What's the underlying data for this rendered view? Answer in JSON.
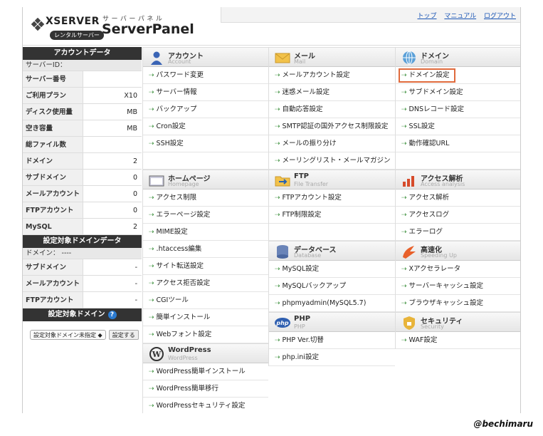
{
  "header": {
    "logo_word": "XSERVER",
    "logo_badge": "レンタルサーバー",
    "panel_sub": "サーバーパネル",
    "panel_title": "ServerPanel",
    "links": [
      "トップ",
      "マニュアル",
      "ログアウト"
    ]
  },
  "account_data": {
    "heading": "アカウントデータ",
    "server_id_label": "サーバーID：",
    "rows": [
      {
        "k": "サーバー番号",
        "v": ""
      },
      {
        "k": "ご利用プラン",
        "v": "X10"
      },
      {
        "k": "ディスク使用量",
        "v": "MB"
      },
      {
        "k": "空き容量",
        "v": "MB"
      },
      {
        "k": "総ファイル数",
        "v": ""
      },
      {
        "k": "ドメイン",
        "v": "2"
      },
      {
        "k": "サブドメイン",
        "v": "0"
      },
      {
        "k": "メールアカウント",
        "v": "0"
      },
      {
        "k": "FTPアカウント",
        "v": "0"
      },
      {
        "k": "MySQL",
        "v": "2"
      }
    ]
  },
  "target_domain_data": {
    "heading": "設定対象ドメインデータ",
    "domain_label": "ドメイン： ----",
    "rows": [
      {
        "k": "サブドメイン",
        "v": "-"
      },
      {
        "k": "メールアカウント",
        "v": "-"
      },
      {
        "k": "FTPアカウント",
        "v": "-"
      }
    ]
  },
  "target_domain": {
    "heading": "設定対象ドメイン",
    "help": "?",
    "select_value": "設定対象ドメイン未指定 ◆",
    "set_button": "設定する"
  },
  "columns": [
    [
      {
        "title": "アカウント",
        "en": "Account",
        "icon": "person-icon",
        "items": [
          "パスワード変更",
          "サーバー情報",
          "バックアップ",
          "Cron設定",
          "SSH設定",
          ""
        ]
      },
      {
        "title": "ホームページ",
        "en": "Homepage",
        "icon": "homepage-icon",
        "items": [
          "アクセス制限",
          "エラーページ設定",
          "MIME設定",
          ".htaccess編集",
          "サイト転送設定",
          "アクセス拒否設定",
          "CGIツール",
          "簡単インストール",
          "Webフォント設定"
        ]
      },
      {
        "title": "WordPress",
        "en": "WordPress",
        "icon": "wordpress-icon",
        "items": [
          "WordPress簡単インストール",
          "WordPress簡単移行",
          "WordPressセキュリティ設定"
        ]
      }
    ],
    [
      {
        "title": "メール",
        "en": "Mail",
        "icon": "mail-icon",
        "items": [
          "メールアカウント設定",
          "迷惑メール設定",
          "自動応答設定",
          "SMTP認証の国外アクセス制限設定",
          "メールの振り分け",
          "メーリングリスト・メールマガジン"
        ]
      },
      {
        "title": "FTP",
        "en": "File Transfer",
        "icon": "ftp-folder-icon",
        "items": [
          "FTPアカウント設定",
          "FTP制限設定",
          ""
        ]
      },
      {
        "title": "データベース",
        "en": "Database",
        "icon": "database-icon",
        "items": [
          "MySQL設定",
          "MySQLバックアップ",
          "phpmyadmin(MySQL5.7)"
        ]
      },
      {
        "title": "PHP",
        "en": "PHP",
        "icon": "php-icon",
        "items": [
          "PHP Ver.切替",
          "php.ini設定"
        ]
      }
    ],
    [
      {
        "title": "ドメイン",
        "en": "Domain",
        "icon": "globe-icon",
        "items": [
          "ドメイン設定",
          "サブドメイン設定",
          "DNSレコード設定",
          "SSL設定",
          "動作確認URL",
          ""
        ]
      },
      {
        "title": "アクセス解析",
        "en": "Access analysis",
        "icon": "chart-icon",
        "items": [
          "アクセス解析",
          "アクセスログ",
          "エラーログ"
        ]
      },
      {
        "title": "高速化",
        "en": "Speeding Up",
        "icon": "speed-icon",
        "items": [
          "Xアクセラレータ",
          "サーバーキャッシュ設定",
          "ブラウザキャッシュ設定"
        ]
      },
      {
        "title": "セキュリティ",
        "en": "Security",
        "icon": "lock-icon",
        "items": [
          "WAF設定"
        ]
      }
    ]
  ],
  "highlighted_item": "ドメイン設定",
  "credit": "@bechimaru"
}
